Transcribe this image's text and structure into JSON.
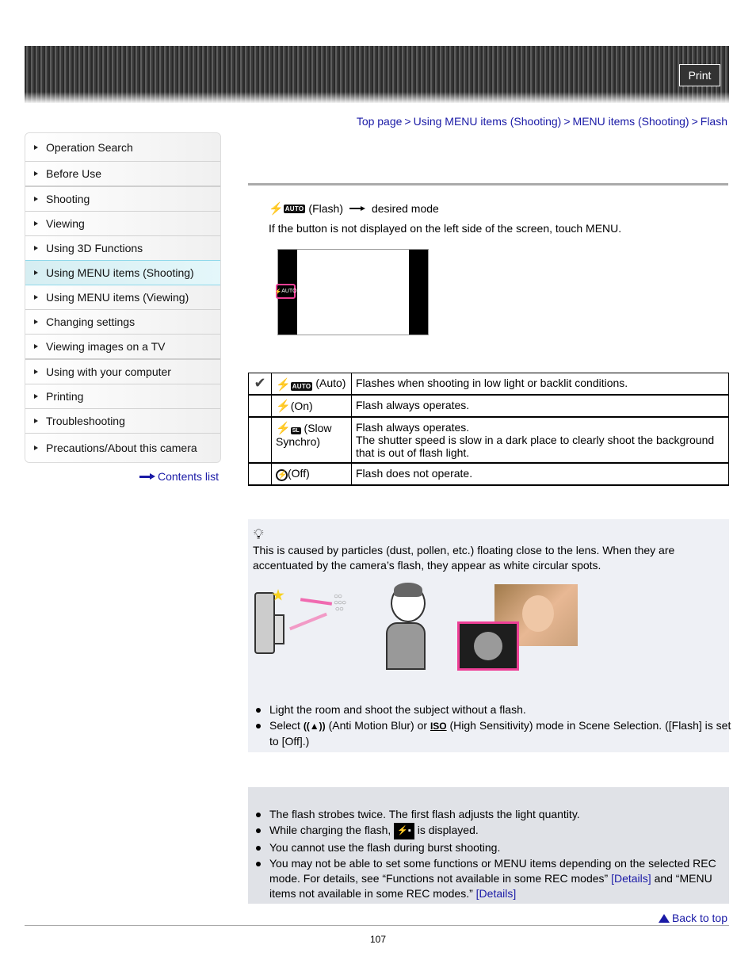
{
  "header": {
    "print_label": "Print"
  },
  "breadcrumb": {
    "items": [
      "Top page",
      "Using MENU items (Shooting)",
      "MENU items (Shooting)",
      "Flash"
    ],
    "separator": ">"
  },
  "sidebar": {
    "items": [
      {
        "label": "Operation Search"
      },
      {
        "label": "Before Use"
      },
      {
        "label": "Shooting"
      },
      {
        "label": "Viewing"
      },
      {
        "label": "Using 3D Functions"
      },
      {
        "label": "Using MENU items (Shooting)",
        "active": true
      },
      {
        "label": "Using MENU items (Viewing)"
      },
      {
        "label": "Changing settings"
      },
      {
        "label": "Viewing images on a TV"
      },
      {
        "label": "Using with your computer"
      },
      {
        "label": "Printing"
      },
      {
        "label": "Troubleshooting"
      },
      {
        "label": "Precautions/About this camera"
      }
    ],
    "contents_list": "Contents list"
  },
  "main": {
    "step": {
      "icon_label": "AUTO",
      "text": "(Flash)",
      "result": "desired mode"
    },
    "step_note": "If the button is not displayed on the left side of the screen, touch MENU.",
    "screen_icon_label": "AUTO",
    "modes": [
      {
        "default": true,
        "icon": "flash-auto",
        "icon_text": "AUTO",
        "name": "(Auto)",
        "description": [
          "Flashes when shooting in low light or backlit conditions."
        ]
      },
      {
        "default": false,
        "icon": "flash-on",
        "icon_text": "",
        "name": "(On)",
        "description": [
          "Flash always operates."
        ]
      },
      {
        "default": false,
        "icon": "flash-slow-synchro",
        "icon_text": "SL",
        "name": "(Slow Synchro)",
        "description": [
          "Flash always operates.",
          "The shutter speed is slow in a dark place to clearly shoot the background that is out of flash light."
        ]
      },
      {
        "default": false,
        "icon": "flash-off",
        "icon_text": "",
        "name": "(Off)",
        "description": [
          "Flash does not operate."
        ]
      }
    ],
    "hint": {
      "text": "This is caused by particles (dust, pollen, etc.) floating close to the lens. When they are accentuated by the camera’s flash, they appear as white circular spots.",
      "items": [
        {
          "text": "Light the room and shoot the subject without a flash."
        },
        {
          "pre": "Select",
          "icon1": "((▲))",
          "mid1": "(Anti Motion Blur) or",
          "icon2": "ISO",
          "mid2": "(High Sensitivity) mode in Scene Selection. ([Flash] is set to [Off].)"
        }
      ]
    },
    "notes": {
      "item1": "The flash strobes twice. The first flash adjusts the light quantity.",
      "item2_pre": "While charging the flash,",
      "item2_icon": "⚡▪",
      "item2_post": "is displayed.",
      "item3": "You cannot use the flash during burst shooting.",
      "item4_pre": "You may not be able to set some functions or MENU items depending on the selected REC mode. For details, see “Functions not available in some REC modes”",
      "item4_link1": "[Details]",
      "item4_mid": "and “MENU items not available in some REC modes.”",
      "item4_link2": "[Details]"
    }
  },
  "footer": {
    "back_to_top": "Back to top",
    "page_number": "107"
  },
  "colors": {
    "link": "#1a1aa6",
    "active_nav": "#d6eef2",
    "highlight_pink": "#ee3f96",
    "hint_bg": "#eef0f5",
    "note_bg": "#e0e2e7"
  }
}
